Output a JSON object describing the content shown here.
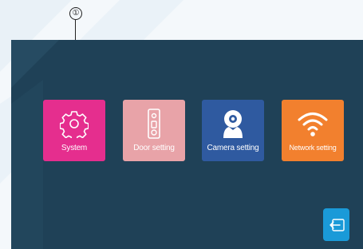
{
  "callout": {
    "number": "①"
  },
  "menu": {
    "tiles": [
      {
        "label": "System",
        "icon": "gear-icon",
        "color": "#e52e8e"
      },
      {
        "label": "Door setting",
        "icon": "doorbell-icon",
        "color": "#e8a3a8"
      },
      {
        "label": "Camera setting",
        "icon": "webcam-icon",
        "color": "#2f5aa0"
      },
      {
        "label": "Network setting",
        "icon": "wifi-icon",
        "color": "#f2802e"
      }
    ]
  },
  "exit_button": {
    "icon": "exit-icon",
    "color": "#1a9ad8"
  },
  "colors": {
    "screen_background": "#1f4157"
  }
}
